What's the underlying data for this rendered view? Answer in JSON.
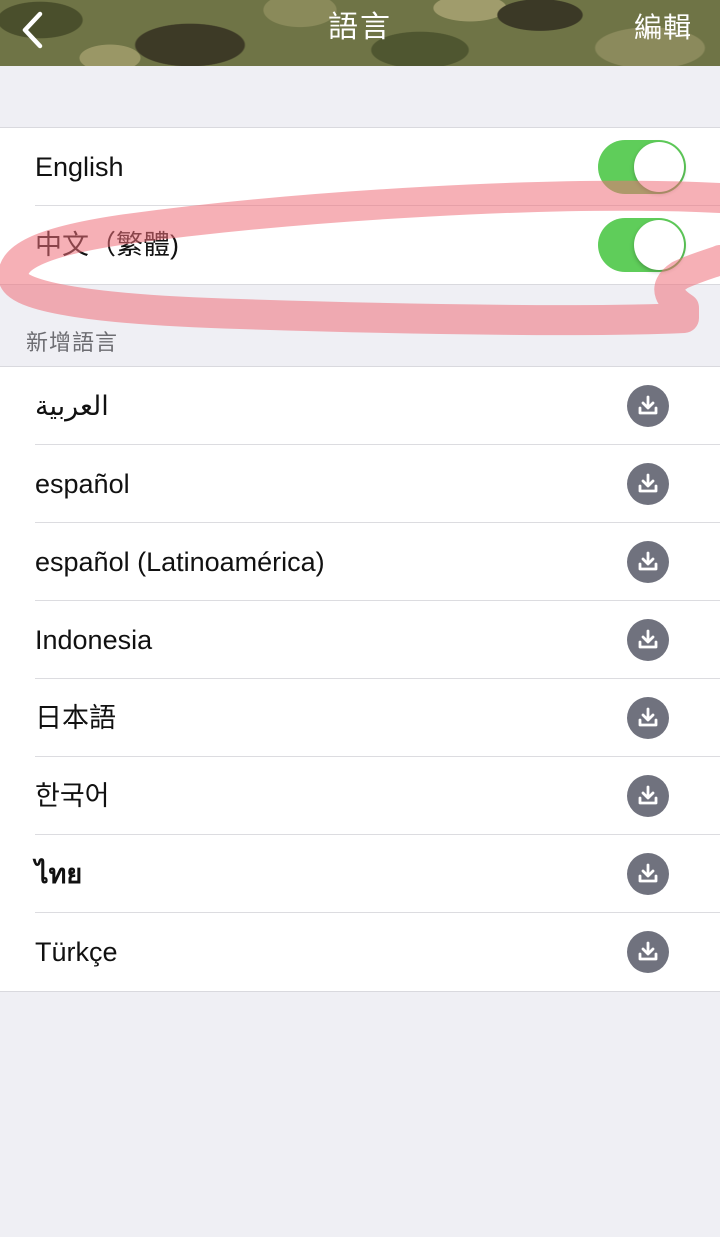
{
  "nav": {
    "back_icon": "chevron-left-icon",
    "title": "語言",
    "edit_label": "編輯"
  },
  "installed": [
    {
      "label": "English",
      "enabled": true
    },
    {
      "label": "中文（繁體)",
      "enabled": true
    }
  ],
  "add_section": {
    "header": "新增語言",
    "items": [
      {
        "label": "العربية",
        "icon": "download-icon"
      },
      {
        "label": "español",
        "icon": "download-icon"
      },
      {
        "label": "español (Latinoamérica)",
        "icon": "download-icon"
      },
      {
        "label": "Indonesia",
        "icon": "download-icon"
      },
      {
        "label": "日本語",
        "icon": "download-icon"
      },
      {
        "label": "한국어",
        "icon": "download-icon"
      },
      {
        "label": "ไทย",
        "icon": "download-icon"
      },
      {
        "label": "Türkçe",
        "icon": "download-icon"
      }
    ]
  },
  "colors": {
    "toggle_on": "#5fcd5a",
    "download_icon": "#70727e",
    "annotation": "#ee6f7a",
    "background": "#efeff4"
  }
}
